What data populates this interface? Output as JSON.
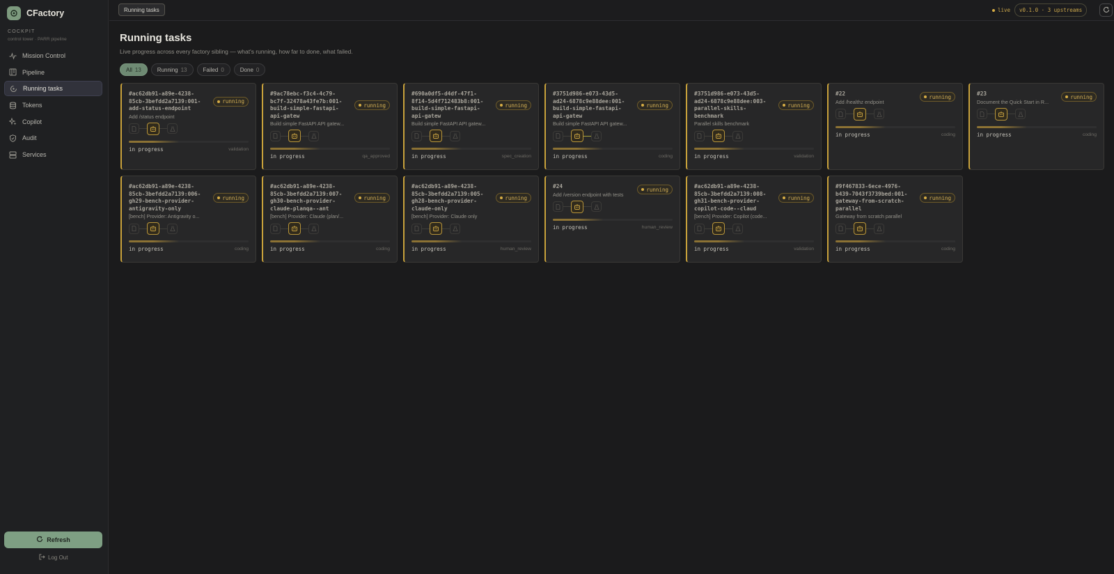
{
  "app": {
    "name": "CFactory"
  },
  "sidebar": {
    "section_title": "COCKPIT",
    "section_subtitle": "control tower · PARR pipeline",
    "items": [
      {
        "label": "Mission Control",
        "icon": "pulse-icon"
      },
      {
        "label": "Pipeline",
        "icon": "kanban-icon"
      },
      {
        "label": "Running tasks",
        "icon": "spinner-icon"
      },
      {
        "label": "Tokens",
        "icon": "database-icon"
      },
      {
        "label": "Copilot",
        "icon": "sparkles-icon"
      },
      {
        "label": "Audit",
        "icon": "shield-icon"
      },
      {
        "label": "Services",
        "icon": "server-icon"
      }
    ],
    "refresh_label": "Refresh",
    "logout_label": "Log Out"
  },
  "topbar": {
    "breadcrumb": "Running tasks",
    "live_label": "live",
    "version_label": "v0.1.0 · 3 upstreams"
  },
  "main": {
    "title": "Running tasks",
    "subtitle": "Live progress across every factory sibling — what's running, how far to done, what failed.",
    "filters": [
      {
        "label": "All",
        "count": "13"
      },
      {
        "label": "Running",
        "count": "13"
      },
      {
        "label": "Failed",
        "count": "0"
      },
      {
        "label": "Done",
        "count": "0"
      }
    ]
  },
  "cards": [
    {
      "title": "#ac62db91-a89e-4238-85cb-3befdd2a7139:001-add-status-endpoint",
      "desc": "Add /status endpoint",
      "status": "running",
      "progress": "in progress",
      "stage": "validation"
    },
    {
      "title": "#9ac78ebc-f3c4-4c79-bc7f-32478a43fe7b:001-build-simple-fastapi-api-gatew",
      "desc": "Build simple FastAPI API gatew...",
      "status": "running",
      "progress": "in progress",
      "stage": "qa_approved"
    },
    {
      "title": "#690a0df5-d4df-47f1-8f14-5d4f712483b8:001-build-simple-fastapi-api-gatew",
      "desc": "Build simple FastAPI API gatew...",
      "status": "running",
      "progress": "in progress",
      "stage": "spec_creation"
    },
    {
      "title": "#3751d986-e073-43d5-ad24-6878c9e88dee:001-build-simple-fastapi-api-gatew",
      "desc": "Build simple FastAPI API gatew...",
      "status": "running",
      "progress": "in progress",
      "stage": "coding"
    },
    {
      "title": "#3751d986-e073-43d5-ad24-6878c9e88dee:003-parallel-skills-benchmark",
      "desc": "Parallel skills benchmark",
      "status": "running",
      "progress": "in progress",
      "stage": "validation"
    },
    {
      "title": "#22",
      "desc": "Add /healthz endpoint",
      "status": "running",
      "progress": "in progress",
      "stage": "coding"
    },
    {
      "title": "#23",
      "desc": "Document the Quick Start in R...",
      "status": "running",
      "progress": "in progress",
      "stage": "coding"
    },
    {
      "title": "#ac62db91-a89e-4238-85cb-3befdd2a7139:006-gh29-bench-provider-antigravity-only",
      "desc": "[bench] Provider: Antigravity o...",
      "status": "running",
      "progress": "in progress",
      "stage": "coding"
    },
    {
      "title": "#ac62db91-a89e-4238-85cb-3befdd2a7139:007-gh30-bench-provider-claude-planqa--ant",
      "desc": "[bench] Provider: Claude (plan/...",
      "status": "running",
      "progress": "in progress",
      "stage": "coding"
    },
    {
      "title": "#ac62db91-a89e-4238-85cb-3befdd2a7139:005-gh28-bench-provider-claude-only",
      "desc": "[bench] Provider: Claude only",
      "status": "running",
      "progress": "in progress",
      "stage": "human_review"
    },
    {
      "title": "#24",
      "desc": "Add /version endpoint with tests",
      "status": "running",
      "progress": "in progress",
      "stage": "human_review"
    },
    {
      "title": "#ac62db91-a89e-4238-85cb-3befdd2a7139:008-gh31-bench-provider-copilot-code--claud",
      "desc": "[bench] Provider: Copilot (code...",
      "status": "running",
      "progress": "in progress",
      "stage": "validation"
    },
    {
      "title": "#9f467833-6ece-4976-b439-7043f3739bed:001-gateway-from-scratch-parallel",
      "desc": "Gateway from scratch parallel",
      "status": "running",
      "progress": "in progress",
      "stage": "coding"
    }
  ]
}
